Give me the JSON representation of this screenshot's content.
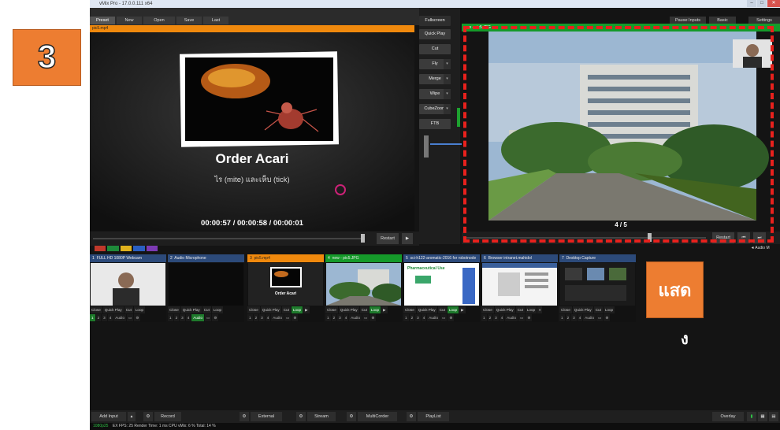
{
  "app": {
    "window_title": "vMix Pro - 17.0.0.111 x64"
  },
  "menubar": {
    "left": [
      "Preset",
      "New",
      "Open",
      "Save",
      "Last"
    ],
    "fullscreen": "Fullscreen",
    "right": [
      "Pause Inputs",
      "Basic",
      "Settings"
    ]
  },
  "preview": {
    "filename": "pic5.mp4",
    "title": "Order Acari",
    "subtitle": "ไร (mite) และเห็บ (tick)",
    "timecode": "00:00:57 / 00:00:58 / 00:00:01",
    "restart": "Restart"
  },
  "transitions": [
    "Quick Play",
    "Cut",
    "Fly",
    "Merge",
    "Wipe",
    "CubeZoom",
    "FTB"
  ],
  "output": {
    "header": "new - pic5.JPG",
    "counter": "4 / 5",
    "restart": "Restart",
    "audio_label": "Audio M"
  },
  "inputs": [
    {
      "num": "1",
      "name": "FULL HD 1080P Webcam",
      "loop": false,
      "audio": false
    },
    {
      "num": "2",
      "name": "Audio Microphone",
      "loop": false,
      "audio": true
    },
    {
      "num": "3",
      "name": "pic5.mp4",
      "loop": true,
      "audio": false,
      "thumb_title": "Order Acari"
    },
    {
      "num": "4",
      "name": "new - pic5.JPG",
      "loop": true,
      "audio": false
    },
    {
      "num": "5",
      "name": "sci-h122-aromatic-2016 for robotnode",
      "loop": true,
      "audio": false,
      "thumb_title": "Pharmaceutical Use"
    },
    {
      "num": "6",
      "name": "Browser intranet.mahidol",
      "loop": false,
      "audio": false
    },
    {
      "num": "7",
      "name": "Desktop Capture",
      "loop": false,
      "audio": false
    }
  ],
  "input_controls": {
    "close": "Close",
    "quick_play": "Quick Play",
    "cut": "Cut",
    "loop": "Loop",
    "audio": "Audio",
    "layers": [
      "1",
      "2",
      "3",
      "4"
    ]
  },
  "bottombar": {
    "add_input": "Add Input",
    "record": "Record",
    "external": "External",
    "stream": "Stream",
    "multicorder": "MultiCorder",
    "playlist": "PlayList",
    "overlay": "Overlay"
  },
  "status": {
    "resolution": "1080p25",
    "text": "EX  FPS: 25  Render Time: 1 ms  CPU vMix: 6 %  Total: 14 %"
  },
  "annotations": {
    "step": "3",
    "show_label": "แสด",
    "show_tail": "ง"
  },
  "colors": {
    "preview_header": "#f0890d",
    "output_header": "#159a2a",
    "annotation": "#ed7d31",
    "highlight_dash": "#e8211d"
  }
}
